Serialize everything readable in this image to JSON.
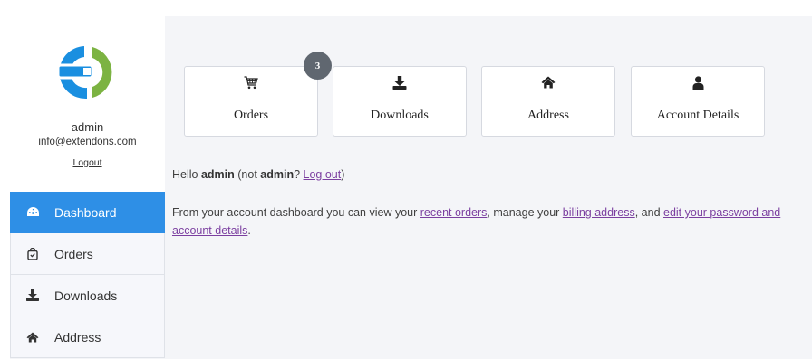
{
  "user": {
    "name": "admin",
    "email": "info@extendons.com",
    "logout_label": "Logout"
  },
  "nav": {
    "items": [
      {
        "label": "Dashboard",
        "icon": "dashboard-icon",
        "active": true
      },
      {
        "label": "Orders",
        "icon": "shopping-bag-icon"
      },
      {
        "label": "Downloads",
        "icon": "download-icon"
      },
      {
        "label": "Address",
        "icon": "home-icon"
      }
    ]
  },
  "cards": [
    {
      "label": "Orders",
      "icon": "cart-icon"
    },
    {
      "label": "Downloads",
      "icon": "download-icon"
    },
    {
      "label": "Address",
      "icon": "home-icon"
    },
    {
      "label": "Account Details",
      "icon": "user-icon"
    }
  ],
  "badge": {
    "count": "3"
  },
  "hello": {
    "prefix": "Hello ",
    "name": "admin",
    "not_prefix": " (not ",
    "not_name": "admin",
    "question": "? ",
    "logout_link": "Log out",
    "suffix": ")"
  },
  "intro": {
    "text1": "From your account dashboard you can view your ",
    "link1": "recent orders",
    "text2": ", manage your ",
    "link2": "billing address",
    "text3": ", and ",
    "link3a": "edit your password and",
    "link3b": "account details",
    "text4": "."
  },
  "colors": {
    "accent": "#2e8fe6",
    "link": "#7b3fa0",
    "badge": "#606770",
    "logo_blue": "#1a8fe0",
    "logo_green": "#7cb342"
  }
}
